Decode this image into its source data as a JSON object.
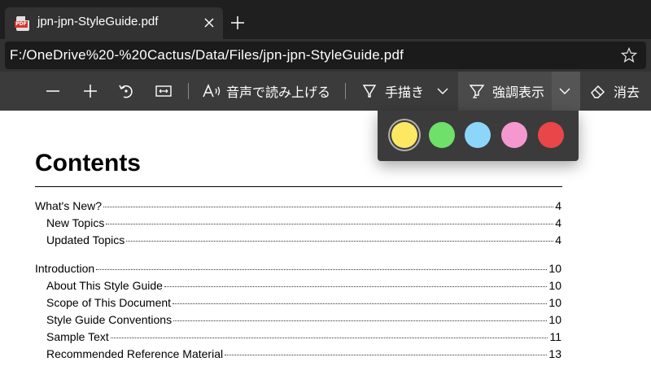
{
  "browser": {
    "tab": {
      "title": "jpn-jpn-StyleGuide.pdf",
      "icon": "pdf-file-icon",
      "icon_badge": "PDF"
    },
    "address": "F:/OneDrive%20-%20Cactus/Data/Files/jpn-jpn-StyleGuide.pdf"
  },
  "toolbar": {
    "read_aloud": "音声で読み上げる",
    "draw": "手描き",
    "highlight": "強調表示",
    "erase": "消去"
  },
  "highlight_colors": [
    {
      "name": "yellow",
      "hex": "#fce862",
      "selected": true
    },
    {
      "name": "green",
      "hex": "#6fe06a",
      "selected": false
    },
    {
      "name": "blue",
      "hex": "#8dd6fb",
      "selected": false
    },
    {
      "name": "pink",
      "hex": "#f598cf",
      "selected": false
    },
    {
      "name": "red",
      "hex": "#e94649",
      "selected": false
    }
  ],
  "document": {
    "heading": "Contents",
    "toc": [
      {
        "title": "What's New?",
        "page": "4",
        "level": 0
      },
      {
        "title": "New Topics",
        "page": "4",
        "level": 1
      },
      {
        "title": "Updated Topics",
        "page": "4",
        "level": 1
      },
      {
        "title": "Introduction",
        "page": "10",
        "level": 0
      },
      {
        "title": "About This Style Guide",
        "page": "10",
        "level": 1
      },
      {
        "title": "Scope of This Document",
        "page": "10",
        "level": 1
      },
      {
        "title": "Style Guide Conventions",
        "page": "10",
        "level": 1
      },
      {
        "title": "Sample Text",
        "page": "11",
        "level": 1
      },
      {
        "title": "Recommended Reference Material",
        "page": "13",
        "level": 1
      }
    ]
  }
}
